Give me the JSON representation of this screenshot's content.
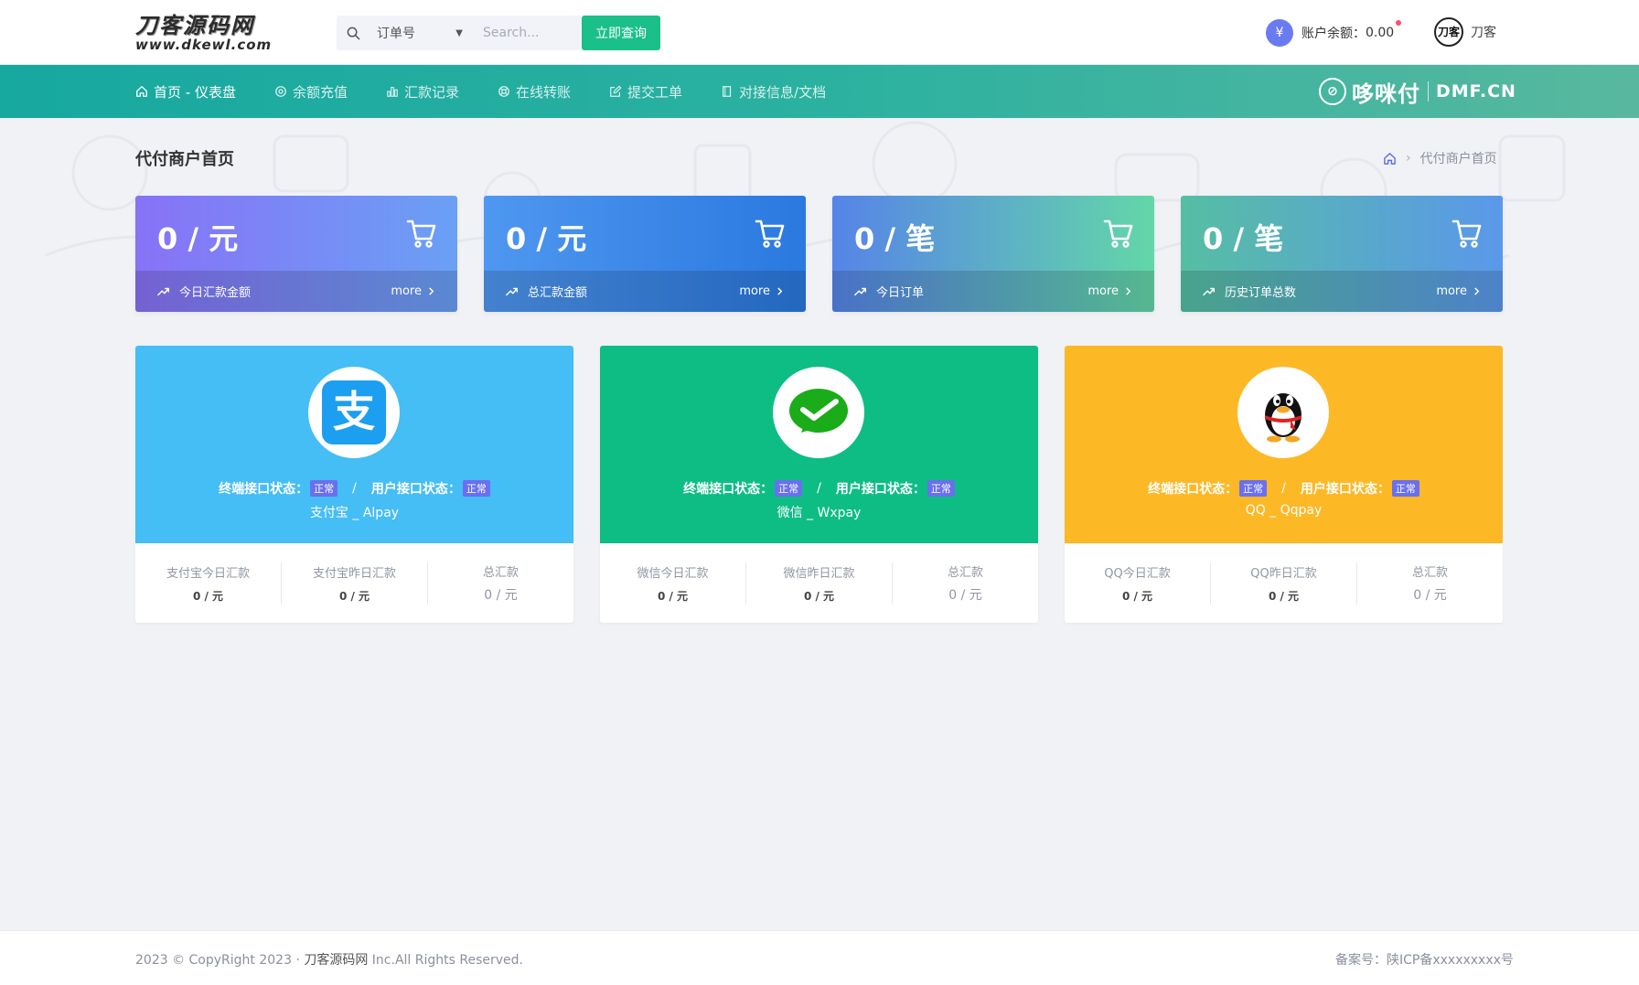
{
  "header": {
    "logo_main": "刀客源码网",
    "logo_sub": "www.dkewl.com",
    "search_type": "订单号",
    "search_placeholder": "Search...",
    "search_button": "立即查询",
    "balance_symbol": "¥",
    "balance_label": "账户余额：",
    "balance_value": "0.00",
    "avatar_text": "刀客",
    "username": "刀客"
  },
  "nav": {
    "items": [
      {
        "label": "首页 - 仪表盘",
        "icon": "home-icon"
      },
      {
        "label": "余额充值",
        "icon": "target-icon"
      },
      {
        "label": "汇款记录",
        "icon": "bar-chart-icon"
      },
      {
        "label": "在线转账",
        "icon": "life-ring-icon"
      },
      {
        "label": "提交工单",
        "icon": "edit-icon"
      },
      {
        "label": "对接信息/文档",
        "icon": "book-icon"
      }
    ],
    "brand_name": "哆咪付",
    "brand_domain": "DMF.CN"
  },
  "page": {
    "title": "代付商户首页",
    "breadcrumb_current": "代付商户首页"
  },
  "stats": [
    {
      "value": "0 / 元",
      "label": "今日汇款金额",
      "more": "more"
    },
    {
      "value": "0 / 元",
      "label": "总汇款金额",
      "more": "more"
    },
    {
      "value": "0 / 笔",
      "label": "今日订单",
      "more": "more"
    },
    {
      "value": "0 / 笔",
      "label": "历史订单总数",
      "more": "more"
    }
  ],
  "payments": [
    {
      "terminal_label": "终端接口状态：",
      "terminal_status": "正常",
      "user_label": "用户接口状态：",
      "user_status": "正常",
      "separator": "/",
      "name": "支付宝 _ Alpay",
      "stats": [
        {
          "label": "支付宝今日汇款",
          "value": "0 / 元"
        },
        {
          "label": "支付宝昨日汇款",
          "value": "0 / 元"
        },
        {
          "label": "总汇款",
          "value": "0 / 元"
        }
      ]
    },
    {
      "terminal_label": "终端接口状态：",
      "terminal_status": "正常",
      "user_label": "用户接口状态：",
      "user_status": "正常",
      "separator": "/",
      "name": "微信 _ Wxpay",
      "stats": [
        {
          "label": "微信今日汇款",
          "value": "0 / 元"
        },
        {
          "label": "微信昨日汇款",
          "value": "0 / 元"
        },
        {
          "label": "总汇款",
          "value": "0 / 元"
        }
      ]
    },
    {
      "terminal_label": "终端接口状态：",
      "terminal_status": "正常",
      "user_label": "用户接口状态：",
      "user_status": "正常",
      "separator": "/",
      "name": "QQ _ Qqpay",
      "stats": [
        {
          "label": "QQ今日汇款",
          "value": "0 / 元"
        },
        {
          "label": "QQ昨日汇款",
          "value": "0 / 元"
        },
        {
          "label": "总汇款",
          "value": "0 / 元"
        }
      ]
    }
  ],
  "footer": {
    "copyright_prefix": "2023 © CopyRight 2023 ·",
    "site_name": "刀客源码网",
    "copyright_suffix": "Inc.All Rights Reserved.",
    "icp": "备案号：陕ICP备xxxxxxxxx号"
  },
  "colors": {
    "accent_green": "#1bbf89",
    "nav_gradient_start": "#17a8a0",
    "alipay": "#45bdf5",
    "wechat": "#0dbd84",
    "qq": "#fdb826",
    "badge": "#6a6ff0"
  }
}
